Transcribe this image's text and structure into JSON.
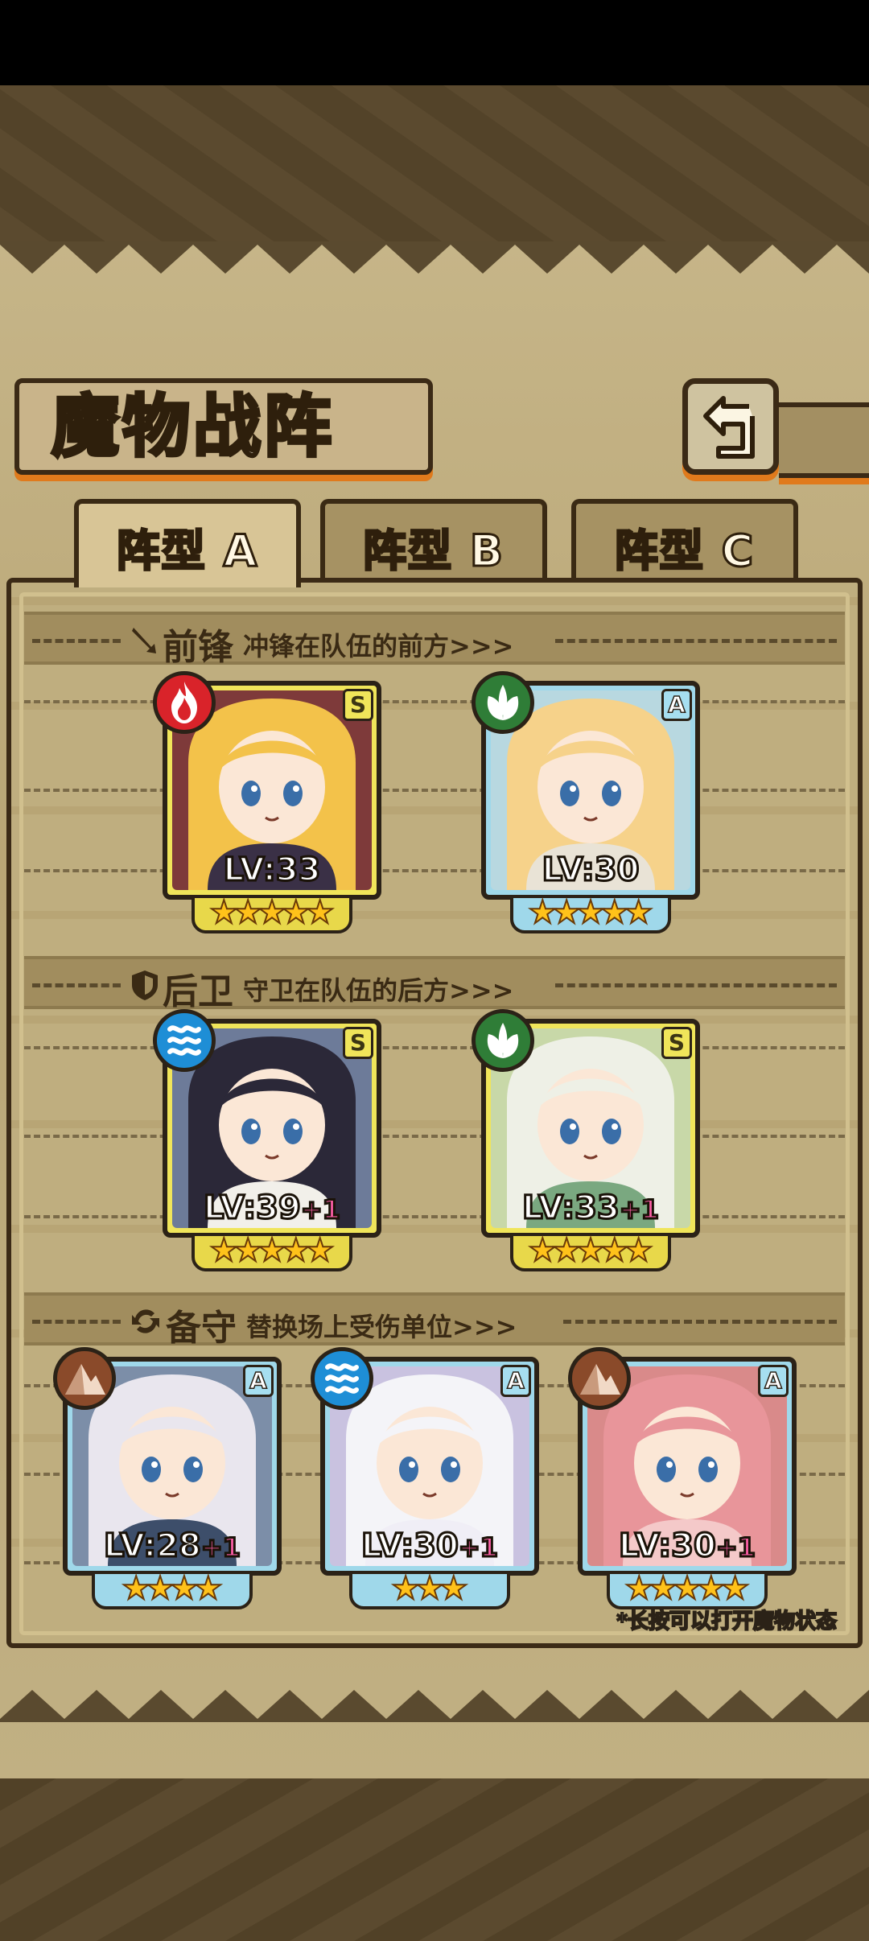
{
  "title": "魔物战阵",
  "tabs": [
    {
      "prefix": "阵型",
      "letter": "A",
      "active": true
    },
    {
      "prefix": "阵型",
      "letter": "B",
      "active": false
    },
    {
      "prefix": "阵型",
      "letter": "C",
      "active": false
    }
  ],
  "sections": {
    "front": {
      "name": "前锋",
      "desc": "冲锋在队伍的前方>>>",
      "icon": "sword-icon"
    },
    "rear": {
      "name": "后卫",
      "desc": "守卫在队伍的后方>>>",
      "icon": "shield-icon"
    },
    "reserve": {
      "name": "备守",
      "desc": "替换场上受伤单位>>>",
      "icon": "swap-icon"
    }
  },
  "units": {
    "front1": {
      "level": "LV:33",
      "plus": "",
      "rank": "S",
      "element": "fire-icon",
      "stars": 5,
      "color": "#d9232a"
    },
    "front2": {
      "level": "LV:30",
      "plus": "",
      "rank": "A",
      "element": "leaf-icon",
      "stars": 5,
      "color": "#2f7d37"
    },
    "rear1": {
      "level": "LV:39",
      "plus": "+1",
      "rank": "S",
      "element": "water-icon",
      "stars": 5,
      "color": "#1e8ed6"
    },
    "rear2": {
      "level": "LV:33",
      "plus": "+1",
      "rank": "S",
      "element": "leaf-icon",
      "stars": 5,
      "color": "#2f7d37"
    },
    "res1": {
      "level": "LV:28",
      "plus": "+1",
      "rank": "A",
      "element": "mountain-icon",
      "stars": 4,
      "color": "#8a4a2a"
    },
    "res2": {
      "level": "LV:30",
      "plus": "+1",
      "rank": "A",
      "element": "water-icon",
      "stars": 3,
      "color": "#1e8ed6"
    },
    "res3": {
      "level": "LV:30",
      "plus": "+1",
      "rank": "A",
      "element": "mountain-icon",
      "stars": 5,
      "color": "#8a4a2a"
    }
  },
  "hint": "*长按可以打开魔物状态"
}
